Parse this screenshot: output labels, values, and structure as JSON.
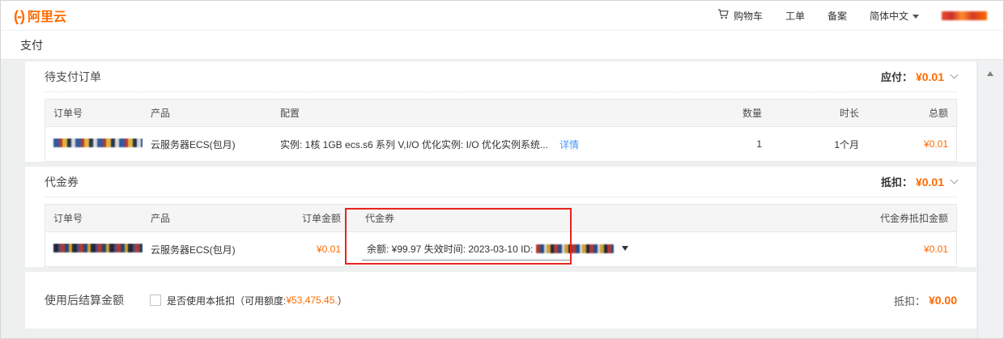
{
  "brand": {
    "logo_bracket": "(-)",
    "logo_text": "阿里云"
  },
  "topnav": {
    "cart_label": "购物车",
    "ticket_label": "工单",
    "beian_label": "备案",
    "lang_label": "简体中文"
  },
  "page_title": "支付",
  "pending": {
    "title": "待支付订单",
    "due_label": "应付：",
    "due_amount": "¥0.01",
    "headers": [
      "订单号",
      "产品",
      "配置",
      "数量",
      "时长",
      "总额"
    ],
    "row": {
      "product": "云服务器ECS(包月)",
      "config": "实例: 1核 1GB ecs.s6 系列 V,I/O 优化实例: I/O 优化实例系统...",
      "detail_link": "详情",
      "quantity": "1",
      "duration": "1个月",
      "total": "¥0.01"
    }
  },
  "voucher": {
    "title": "代金券",
    "deduct_label": "抵扣：",
    "deduct_amount": "¥0.01",
    "headers": [
      "订单号",
      "产品",
      "订单金额",
      "代金券",
      "代金券抵扣金额"
    ],
    "row": {
      "product": "云服务器ECS(包月)",
      "order_amount": "¥0.01",
      "voucher_option": "余额: ¥99.97 失效时间: 2023-03-10 ID:",
      "voucher_deduct": "¥0.01"
    }
  },
  "settlement": {
    "title": "使用后结算金额",
    "checkbox_label": "是否使用本抵扣（可用额度:",
    "available_amount": "¥53,475.45.",
    "label_suffix": "）",
    "deduct_label": "抵扣：",
    "deduct_amount": "¥0.00"
  },
  "icons": {
    "cart": "cart-icon",
    "lang_caret": "caret-down-icon",
    "collapse": "chevron-collapse-icon",
    "scroll_up": "scroll-up-arrow-icon",
    "dropdown": "dropdown-arrow-icon"
  },
  "colors": {
    "brand_orange": "#ff6a00",
    "money_orange": "#ff6a00",
    "link_blue": "#459aff",
    "highlight_red": "#e8241d",
    "content_bg": "#eef0f0"
  }
}
